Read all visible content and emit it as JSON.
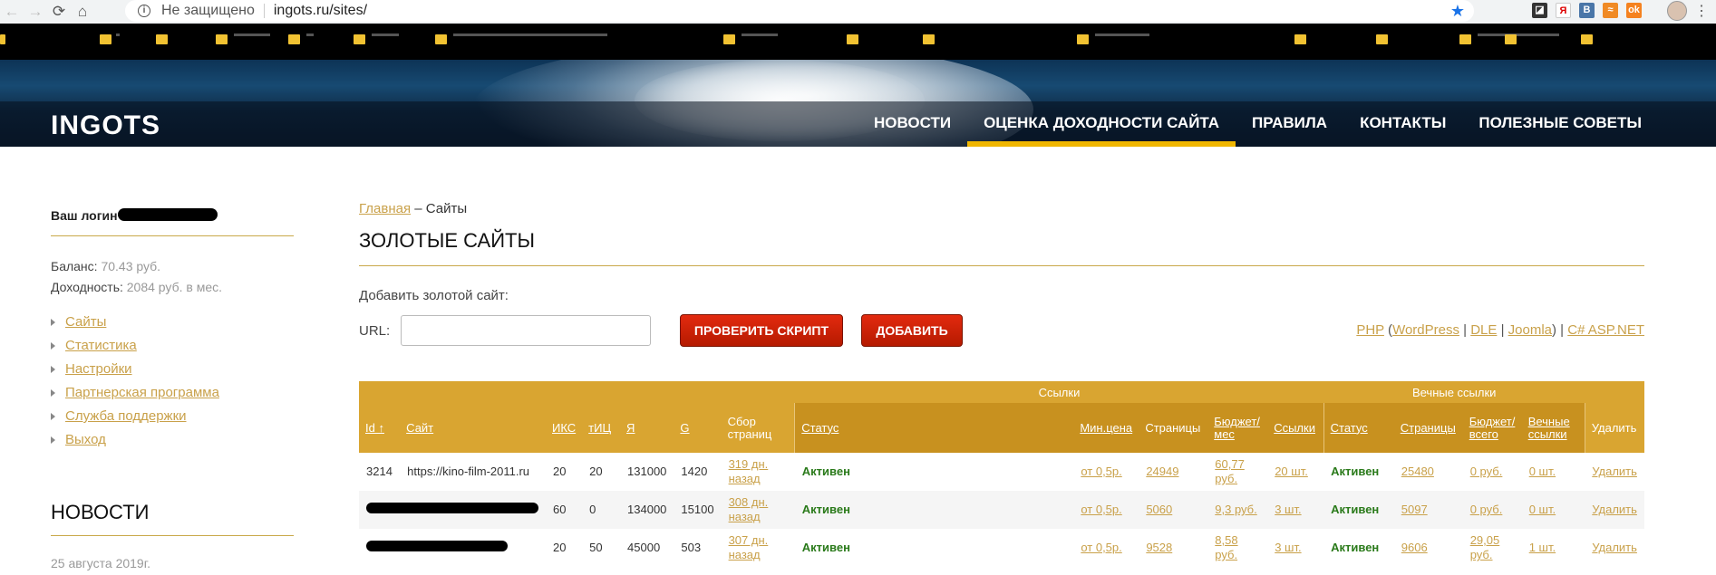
{
  "browser": {
    "insecure_label": "Не защищено",
    "url": "ingots.ru/sites/"
  },
  "header": {
    "logo": "INGOTS",
    "nav": [
      {
        "label": "НОВОСТИ"
      },
      {
        "label": "ОЦЕНКА ДОХОДНОСТИ САЙТА"
      },
      {
        "label": "ПРАВИЛА"
      },
      {
        "label": "КОНТАКТЫ"
      },
      {
        "label": "ПОЛЕЗНЫЕ СОВЕТЫ"
      }
    ]
  },
  "sidebar": {
    "login_label": "Ваш логин",
    "balance_label": "Баланс:",
    "balance_value": "70.43 руб.",
    "income_label": "Доходность:",
    "income_value": "2084 руб. в мес.",
    "menu": [
      {
        "label": "Сайты"
      },
      {
        "label": "Статистика"
      },
      {
        "label": "Настройки"
      },
      {
        "label": "Партнерская программа"
      },
      {
        "label": "Служба поддержки"
      },
      {
        "label": "Выход"
      }
    ],
    "news_title": "НОВОСТИ",
    "news_date": "25 августа 2019г."
  },
  "main": {
    "breadcrumb_home": "Главная",
    "breadcrumb_sep": " – Сайты",
    "title": "ЗОЛОТЫЕ САЙТЫ",
    "add_label": "Добавить золотой сайт:",
    "url_label": "URL:",
    "url_value": "",
    "check_button": "ПРОВЕРИТЬ СКРИПТ",
    "add_button": "ДОБАВИТЬ",
    "platforms": {
      "php": "PHP",
      "open": " (",
      "wordpress": "WordPress",
      "sep1": " | ",
      "dle": "DLE",
      "sep2": " | ",
      "joomla": "Joomla",
      "close": ") | ",
      "aspnet": "C# ASP.NET"
    }
  },
  "table": {
    "group_links": "Ссылки",
    "group_eternal": "Вечные ссылки",
    "columns": {
      "id": "Id ↑",
      "site": "Сайт",
      "iks": "ИКС",
      "tic": "тИЦ",
      "ya": "Я",
      "g": "G",
      "pages_collect": "Сбор страниц",
      "status": "Статус",
      "min_price": "Мин.цена",
      "pages": "Страницы",
      "budget": "Бюджет/ мес",
      "links": "Ссылки",
      "e_status": "Статус",
      "e_pages": "Страницы",
      "e_budget": "Бюджет/ всего",
      "e_links": "Вечные ссылки",
      "delete": "Удалить"
    },
    "rows": [
      {
        "id": "3214",
        "site": "https://kino-film-2011.ru",
        "iks": "20",
        "tic": "20",
        "ya": "131000",
        "g": "1420",
        "collect": "319 дн. назад",
        "status": "Активен",
        "min": "от 0,5р.",
        "pages": "24949",
        "budget": "60,77 руб.",
        "links": "20 шт.",
        "e_status": "Активен",
        "e_pages": "25480",
        "e_budget": "0 руб.",
        "e_links": "0 шт.",
        "delete": "Удалить"
      },
      {
        "id": "",
        "site": "",
        "iks": "60",
        "tic": "0",
        "ya": "134000",
        "g": "15100",
        "collect": "308 дн. назад",
        "status": "Активен",
        "min": "от 0,5р.",
        "pages": "5060",
        "budget": "9,3 руб.",
        "links": "3 шт.",
        "e_status": "Активен",
        "e_pages": "5097",
        "e_budget": "0 руб.",
        "e_links": "0 шт.",
        "delete": "Удалить"
      },
      {
        "id": "",
        "site": "",
        "iks": "20",
        "tic": "50",
        "ya": "45000",
        "g": "503",
        "collect": "307 дн. назад",
        "status": "Активен",
        "min": "от 0,5р.",
        "pages": "9528",
        "budget": "8,58 руб.",
        "links": "3 шт.",
        "e_status": "Активен",
        "e_pages": "9606",
        "e_budget": "29,05 руб.",
        "e_links": "1 шт.",
        "delete": "Удалить"
      }
    ]
  }
}
